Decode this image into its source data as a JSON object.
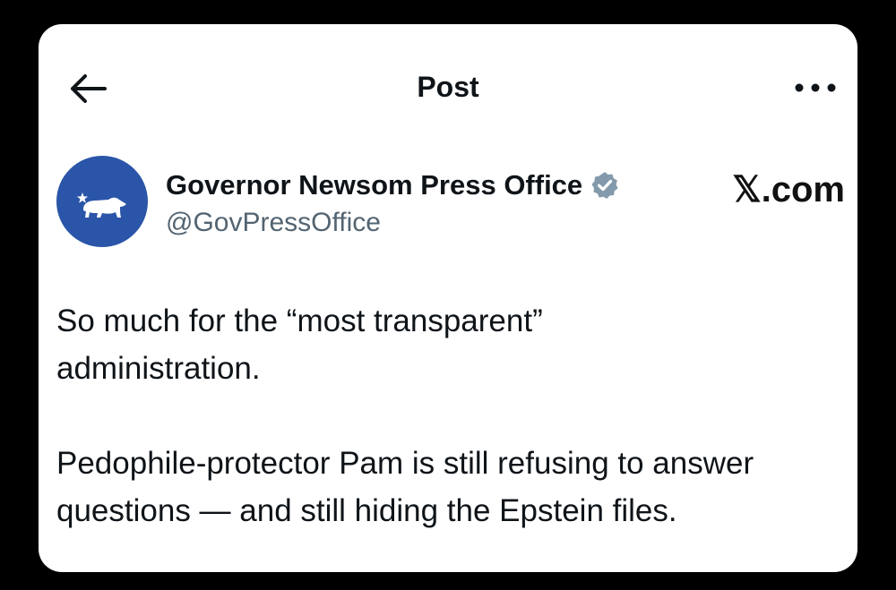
{
  "header": {
    "title": "Post",
    "back_icon": "arrow-left-icon",
    "more_icon": "more-horizontal-icon"
  },
  "author": {
    "name": "Governor Newsom Press Office",
    "handle": "@GovPressOffice",
    "verified_badge_icon": "verified-badge-icon",
    "avatar_icon": "california-bear-flag-icon",
    "avatar_color": "#2a55a8",
    "badge_color": "#829aab"
  },
  "watermark": "𝕏.com",
  "post": {
    "paragraphs": [
      "So much for the “most transparent”\nadministration.",
      "Pedophile-protector Pam is still refusing to answer\nquestions — and still hiding the Epstein files."
    ]
  }
}
